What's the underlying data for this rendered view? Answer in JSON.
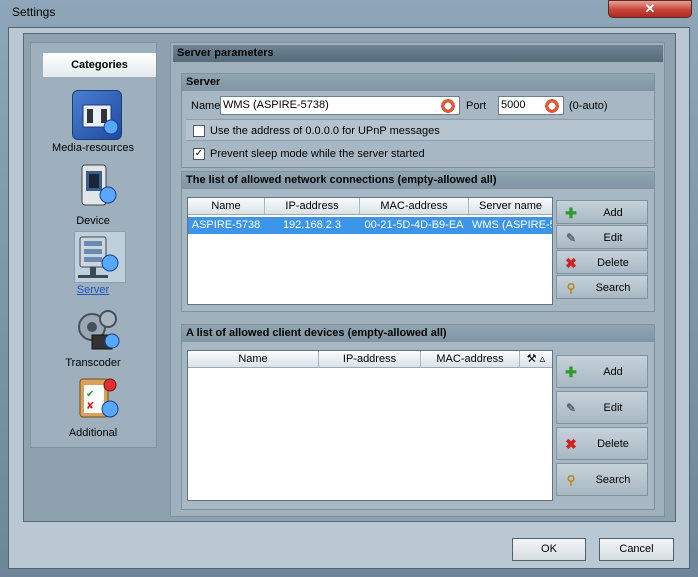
{
  "window": {
    "title": "Settings",
    "close_label": "✕"
  },
  "categories": {
    "header": "Categories",
    "items": [
      {
        "label": "Media-resources",
        "icon": "media-resources-icon"
      },
      {
        "label": "Device",
        "icon": "device-icon"
      },
      {
        "label": "Server",
        "icon": "server-icon",
        "selected": true
      },
      {
        "label": "Transcoder",
        "icon": "transcoder-icon"
      },
      {
        "label": "Additional",
        "icon": "additional-icon"
      }
    ]
  },
  "server_params": {
    "header": "Server parameters",
    "server_group": {
      "header": "Server",
      "name_label": "Name",
      "name_value": "WMS (ASPIRE-5738)",
      "port_label": "Port",
      "port_value": "5000",
      "port_hint": "(0-auto)",
      "upnp_label": "Use the address of 0.0.0.0 for UPnP messages",
      "upnp_checked": false,
      "sleep_label": "Prevent sleep mode while the server started",
      "sleep_checked": true
    },
    "network_group": {
      "header": "The list of allowed network connections (empty-allowed all)",
      "columns": [
        "Name",
        "IP-address",
        "MAC-address",
        "Server name"
      ],
      "rows": [
        [
          "ASPIRE-5738",
          "192.168.2.3",
          "00-21-5D-4D-B9-EA",
          "WMS (ASPIRE-5"
        ]
      ],
      "buttons": {
        "add": "Add",
        "edit": "Edit",
        "delete": "Delete",
        "search": "Search"
      }
    },
    "devices_group": {
      "header": "A list of allowed client devices (empty-allowed all)",
      "columns": [
        "Name",
        "IP-address",
        "MAC-address"
      ],
      "buttons": {
        "add": "Add",
        "edit": "Edit",
        "delete": "Delete",
        "search": "Search"
      }
    }
  },
  "footer": {
    "ok": "OK",
    "cancel": "Cancel"
  },
  "colors": {
    "accent": "#3d95e7",
    "close": "#c4443a",
    "link": "#1a56c8"
  }
}
